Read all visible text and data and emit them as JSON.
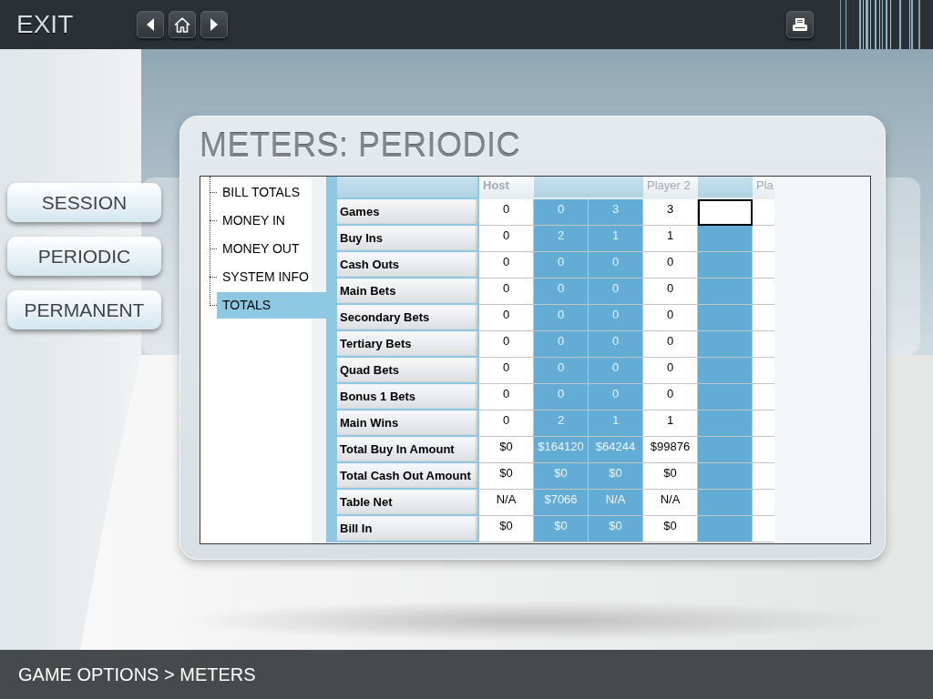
{
  "top_bar": {
    "exit_label": "EXIT"
  },
  "side_nav": [
    {
      "label": "SESSION"
    },
    {
      "label": "PERIODIC"
    },
    {
      "label": "PERMANENT"
    }
  ],
  "panel": {
    "title": "METERS: PERIODIC"
  },
  "tree": [
    {
      "label": "BILL TOTALS",
      "selected": false
    },
    {
      "label": "MONEY IN",
      "selected": false
    },
    {
      "label": "MONEY OUT",
      "selected": false
    },
    {
      "label": "SYSTEM INFO",
      "selected": false
    },
    {
      "label": "TOTALS",
      "selected": true
    }
  ],
  "table": {
    "columns": [
      {
        "kind": "host",
        "header": "Host",
        "shaded": false,
        "selected": false
      },
      {
        "kind": "player",
        "shaded": true,
        "selected": false
      },
      {
        "kind": "player",
        "shaded": true,
        "selected": false
      },
      {
        "kind": "player",
        "header": "Player 2",
        "shaded": false,
        "selected": false
      },
      {
        "kind": "player",
        "shaded": true,
        "selected": true
      },
      {
        "kind": "player",
        "header": "Pla",
        "shaded": false,
        "selected": false
      }
    ],
    "rows": [
      {
        "label": "Games",
        "selected": true,
        "values": [
          "0",
          "0",
          "3",
          "3"
        ]
      },
      {
        "label": "Buy Ins",
        "selected": false,
        "values": [
          "0",
          "2",
          "1",
          "1"
        ]
      },
      {
        "label": "Cash Outs",
        "selected": false,
        "values": [
          "0",
          "0",
          "0",
          "0"
        ]
      },
      {
        "label": "Main Bets",
        "selected": false,
        "values": [
          "0",
          "0",
          "0",
          "0"
        ]
      },
      {
        "label": "Secondary Bets",
        "selected": false,
        "values": [
          "0",
          "0",
          "0",
          "0"
        ]
      },
      {
        "label": "Tertiary Bets",
        "selected": false,
        "values": [
          "0",
          "0",
          "0",
          "0"
        ]
      },
      {
        "label": "Quad Bets",
        "selected": false,
        "values": [
          "0",
          "0",
          "0",
          "0"
        ]
      },
      {
        "label": "Bonus 1 Bets",
        "selected": false,
        "values": [
          "0",
          "0",
          "0",
          "0"
        ]
      },
      {
        "label": "Main Wins",
        "selected": false,
        "values": [
          "0",
          "2",
          "1",
          "1"
        ]
      },
      {
        "label": "Total Buy In Amount",
        "selected": false,
        "values": [
          "$0",
          "$164120",
          "$64244",
          "$99876"
        ]
      },
      {
        "label": "Total Cash Out Amount",
        "selected": false,
        "values": [
          "$0",
          "$0",
          "$0",
          "$0"
        ]
      },
      {
        "label": "Table Net",
        "selected": false,
        "values": [
          "N/A",
          "$7066",
          "N/A",
          "N/A"
        ]
      },
      {
        "label": "Bill In",
        "selected": false,
        "values": [
          "$0",
          "$0",
          "$0",
          "$0"
        ]
      }
    ]
  },
  "status_bar": {
    "breadcrumb": "GAME OPTIONS > METERS"
  }
}
